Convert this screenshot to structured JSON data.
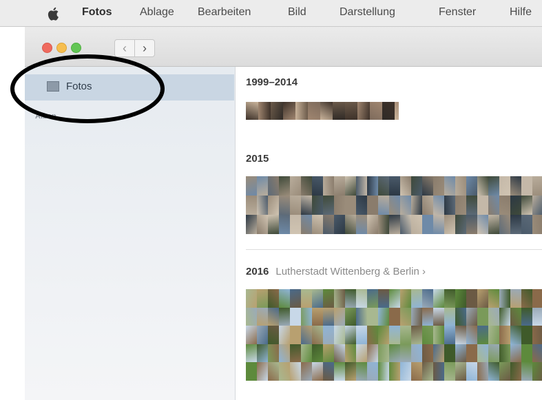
{
  "menubar": {
    "app_name": "Fotos",
    "items": [
      "Ablage",
      "Bearbeiten",
      "Bild",
      "Darstellung",
      "Fenster",
      "Hilfe"
    ]
  },
  "toolbar": {
    "back_glyph": "‹",
    "forward_glyph": "›"
  },
  "sidebar": {
    "selected_item": {
      "label": "Fotos",
      "icon": "photos-library-icon"
    },
    "section_label": "Alben"
  },
  "moments": [
    {
      "year": "1999–2014",
      "location": ""
    },
    {
      "year": "2015",
      "location": ""
    },
    {
      "year": "2016",
      "location": "Lutherstadt Wittenberg & Berlin ›"
    }
  ],
  "colors": {
    "sidebar_selection": "#c9d6e3",
    "annotation": "#000000",
    "close": "#ef6a5e",
    "minimize": "#f6be4f",
    "zoom": "#63c655"
  }
}
